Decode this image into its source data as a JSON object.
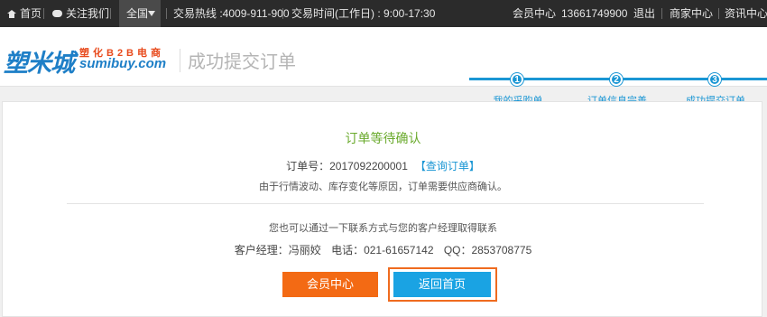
{
  "topbar": {
    "home": "首页",
    "follow": "关注我们",
    "region": "全国",
    "hotline": "交易热线 :4009-911-900",
    "hours": "交易时间(工作日) : 9:00-17:30",
    "member_center": "会员中心",
    "phone": "13661749900",
    "logout": "退出",
    "merchant_center": "商家中心",
    "news_center": "资讯中心"
  },
  "header": {
    "logo_main": "塑米城",
    "logo_sub": "塑化B2B电商",
    "logo_domain": "sumibuy.com",
    "page_title": "成功提交订单"
  },
  "steps": [
    {
      "num": "1",
      "label": "我的采购单"
    },
    {
      "num": "2",
      "label": "订单信息完善"
    },
    {
      "num": "3",
      "label": "成功提交订单"
    }
  ],
  "order": {
    "status": "订单等待确认",
    "number_label": "订单号：",
    "number": "2017092200001",
    "query_link": "【查询订单】",
    "reason": "由于行情波动、库存变化等原因，订单需要供应商确认。",
    "contact_tip": "您也可以通过一下联系方式与您的客户经理取得联系",
    "manager": "客户经理：冯丽姣",
    "tel": "电话：021-61657142",
    "qq": "QQ：2853708775"
  },
  "buttons": {
    "member_center": "会员中心",
    "back_home": "返回首页"
  },
  "colors": {
    "accent_blue": "#1a96d4",
    "accent_orange": "#f36a14",
    "status_green": "#6aaa2c"
  }
}
